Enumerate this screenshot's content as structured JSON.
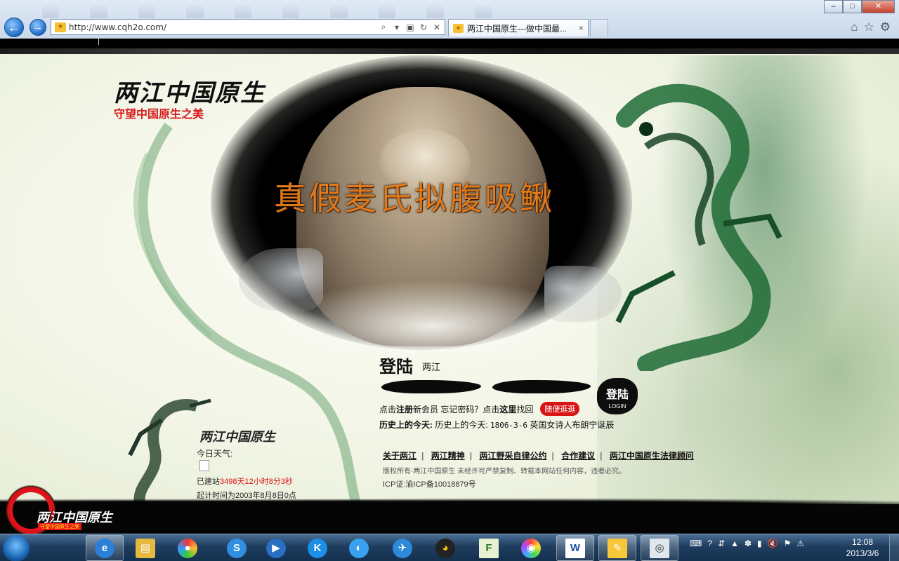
{
  "browser": {
    "url": "http://www.cqh2o.com/",
    "tab_title": "两江中国原生---做中国最...",
    "tab_close": "×",
    "back_label": "←",
    "forward_label": "→",
    "minimize": "–",
    "maximize": "□",
    "close": "✕",
    "icons": [
      "home-icon",
      "favorites-star-icon",
      "settings-gear-icon"
    ]
  },
  "hero": {
    "logo_text": "两江中国原生",
    "slogan": "守望中国原生之美",
    "title": "真假麦氏拟腹吸鳅"
  },
  "login": {
    "title": "登陆",
    "subtitle": "两江",
    "username_value": "",
    "password_value": "",
    "button_label": "登陆",
    "button_sub": "LOGIN",
    "register_prefix": "点击",
    "register_link": "注册",
    "register_suffix": "新会员  忘记密码？点击",
    "recover_link": "这里",
    "recover_suffix": "找回",
    "random_button": "随便逛逛"
  },
  "history": {
    "label": "历史上的今天:",
    "prefix": "历史上的今天:",
    "date": "1806-3-6",
    "event": "英国女诗人布朗宁诞辰"
  },
  "footer": {
    "links": [
      "关于两江",
      "两江精神",
      "两江野采自律公约",
      "合作建议",
      "两江中国原生法律顾问"
    ],
    "separator": "|",
    "copyright": "版权所有·两江中国原生 未经许可严禁复制、转载本网站任何内容，违者必究。",
    "icp": "ICP证:渝ICP备10018879号"
  },
  "sidebar": {
    "title": "两江中国原生",
    "weather_label": "今日天气:",
    "site_age_prefix": "已建站",
    "site_age_value": "3498天12小时8分3秒",
    "start_time": "起计时间为2003年8月8日0点"
  },
  "badge": {
    "text": "两江中国原生",
    "sub": "守望中国原生之美"
  },
  "taskbar": {
    "apps": [
      "ie-icon",
      "explorer-folder-icon",
      "color-ball-icon",
      "sogou-s-icon",
      "media-player-icon",
      "kugou-k-icon",
      "fish-bubble-icon",
      "bird-icon",
      "qq-penguin-icon",
      "f-app-icon",
      "color-wheel-icon",
      "word-icon",
      "sticky-note-icon",
      "screenshot-icon"
    ],
    "app_glyphs": [
      "e",
      "▤",
      "●",
      "S",
      "▶",
      "K",
      "◐",
      "✈",
      "◕",
      "F",
      "◉",
      "W",
      "✎",
      "◎"
    ],
    "time": "12:08",
    "date": "2013/3/6",
    "tray_glyphs": [
      "⌨",
      "?",
      "⇵",
      "▲",
      "✽",
      "▮",
      "🔇",
      "⚑",
      "⚠"
    ]
  }
}
